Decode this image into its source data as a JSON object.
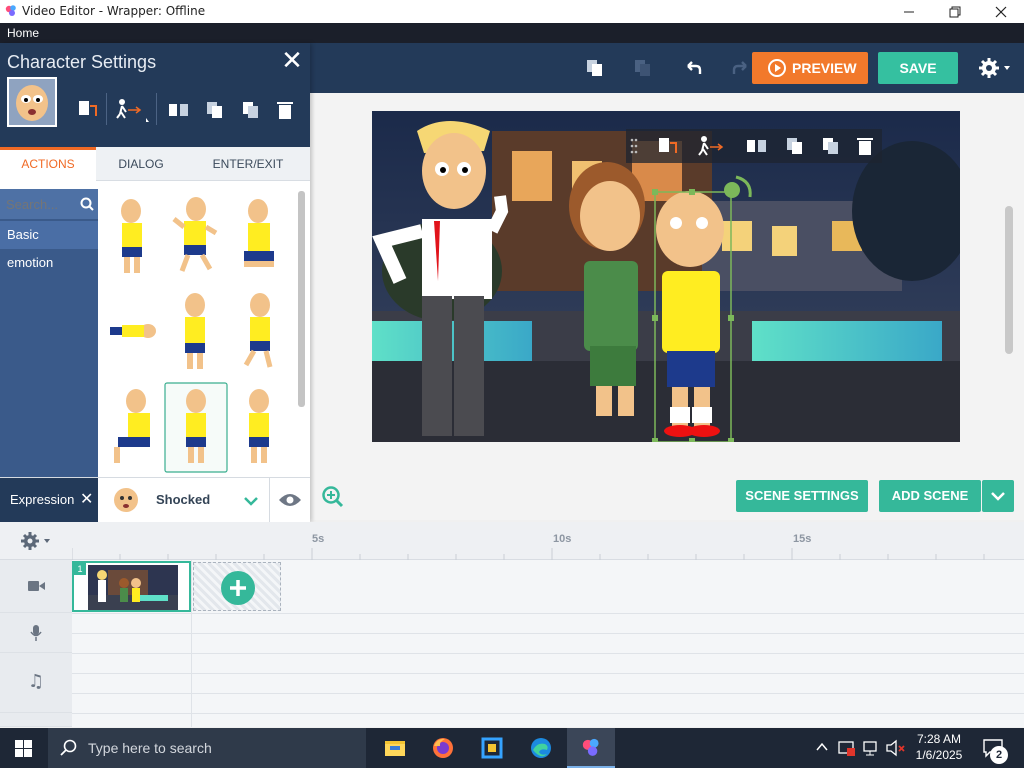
{
  "window": {
    "title": "Video Editor - Wrapper: Offline",
    "min_icon": "minimize-icon",
    "max_icon": "maximize-icon",
    "close_icon": "close-icon"
  },
  "menu": {
    "home": "Home"
  },
  "toolbar": {
    "preview_label": "PREVIEW",
    "save_label": "SAVE",
    "icons": [
      "copy-icon",
      "paste-icon",
      "undo-icon",
      "redo-icon",
      "settings-gear-icon"
    ]
  },
  "panel": {
    "title": "Character Settings",
    "tabs": [
      {
        "label": "ACTIONS",
        "active": true
      },
      {
        "label": "DIALOG",
        "active": false
      },
      {
        "label": "ENTER/EXIT",
        "active": false
      }
    ],
    "search_placeholder": "Search...",
    "categories": [
      {
        "label": "Basic",
        "active": true
      },
      {
        "label": "emotion",
        "active": false
      }
    ],
    "expression_label": "Expression",
    "expression_value": "Shocked"
  },
  "scene_buttons": {
    "scene_settings": "SCENE SETTINGS",
    "add_scene": "ADD SCENE"
  },
  "timeline": {
    "ticks": [
      "5s",
      "10s",
      "15s"
    ],
    "scene_number": "1"
  },
  "taskbar": {
    "search_placeholder": "Type here to search",
    "time": "7:28 AM",
    "date": "1/6/2025",
    "notifications": "2"
  },
  "colors": {
    "accent_orange": "#f2792b",
    "accent_teal": "#35c0a0",
    "navy": "#233a59"
  }
}
